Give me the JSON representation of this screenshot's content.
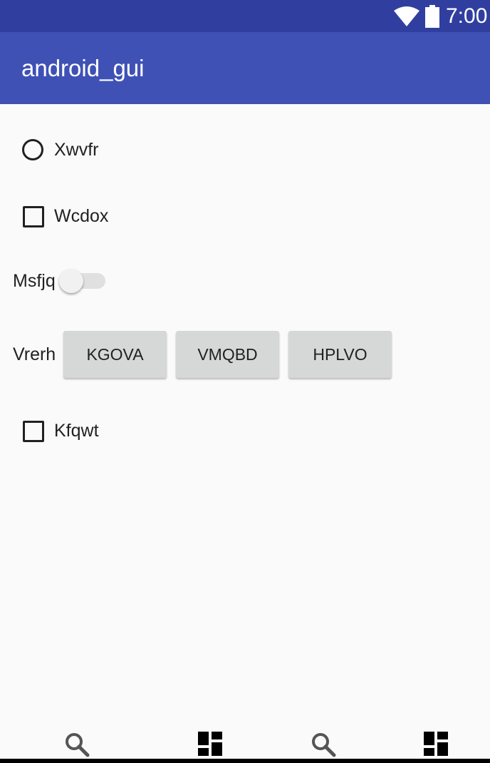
{
  "status_bar": {
    "time": "7:00",
    "wifi_icon": "wifi-icon",
    "battery_icon": "battery-icon"
  },
  "app_bar": {
    "title": "android_gui"
  },
  "controls": {
    "radio_label": "Xwvfr",
    "checkbox1_label": "Wcdox",
    "switch_label": "Msfjq",
    "button_group_label": "Vrerh",
    "buttons": [
      "KGOVA",
      "VMQBD",
      "HPLVO"
    ],
    "checkbox2_label": "Kfqwt"
  },
  "nav_bar": {
    "icons": [
      "search-icon",
      "dashboard-icon",
      "search-icon",
      "dashboard-icon"
    ]
  },
  "colors": {
    "status_bar": "#303f9f",
    "app_bar": "#3f51b5",
    "background": "#fafafa",
    "button": "#d6d7d7"
  }
}
